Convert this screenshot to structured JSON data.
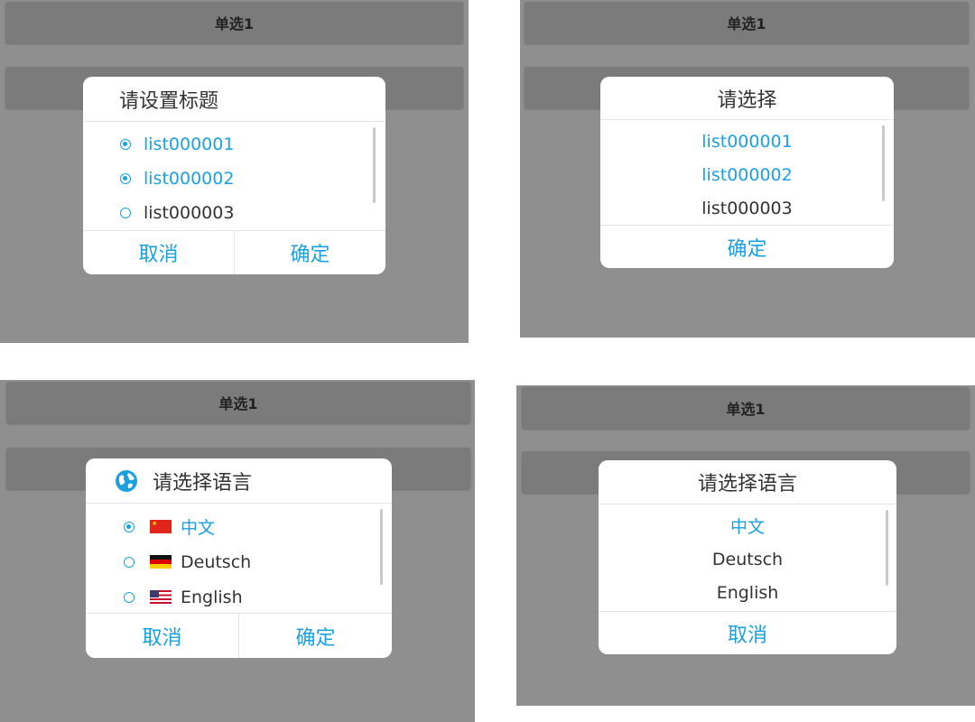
{
  "accent_color": "#1ba0e1",
  "panels": {
    "top_left": {
      "bar_label": "单选1",
      "dialog": {
        "title": "请设置标题",
        "items": [
          {
            "label": "list000001",
            "checked": true
          },
          {
            "label": "list000002",
            "checked": true
          },
          {
            "label": "list000003",
            "checked": false
          }
        ],
        "buttons": {
          "cancel": "取消",
          "ok": "确定"
        }
      }
    },
    "top_right": {
      "bar_label": "单选1",
      "dialog": {
        "title": "请选择",
        "items": [
          {
            "label": "list000001",
            "selected": true
          },
          {
            "label": "list000002",
            "selected": true
          },
          {
            "label": "list000003",
            "selected": false
          }
        ],
        "buttons": {
          "ok": "确定"
        }
      }
    },
    "bottom_left": {
      "bar_label": "单选1",
      "dialog": {
        "title": "请选择语言",
        "title_icon": "globe-icon",
        "items": [
          {
            "label": "中文",
            "checked": true,
            "flag": "china-flag-icon"
          },
          {
            "label": "Deutsch",
            "checked": false,
            "flag": "germany-flag-icon"
          },
          {
            "label": "English",
            "checked": false,
            "flag": "usa-flag-icon"
          }
        ],
        "buttons": {
          "cancel": "取消",
          "ok": "确定"
        }
      }
    },
    "bottom_right": {
      "bar_label": "单选1",
      "dialog": {
        "title": "请选择语言",
        "items": [
          {
            "label": "中文",
            "selected": true
          },
          {
            "label": "Deutsch",
            "selected": false
          },
          {
            "label": "English",
            "selected": false
          }
        ],
        "buttons": {
          "cancel": "取消"
        }
      }
    }
  }
}
